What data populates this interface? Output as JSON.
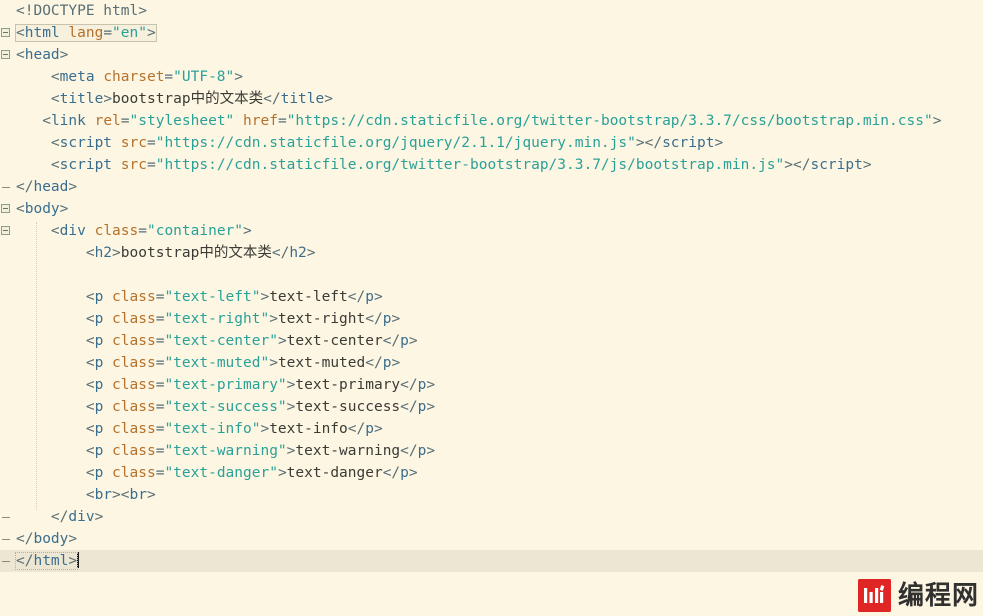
{
  "editor": {
    "theme_name": "solarized-light",
    "background_color": "#fdf6e3",
    "current_line_color": "#ede6d2",
    "colors": {
      "punctuation": "#586e75",
      "tag": "#3a6e8f",
      "attribute": "#b5712a",
      "string": "#2aa198",
      "text": "#3b3b36"
    },
    "language": "html",
    "lines": [
      {
        "n": 1,
        "fold": "",
        "indent": 0,
        "tokens": [
          {
            "t": "doctype",
            "v": "<!DOCTYPE html>"
          }
        ]
      },
      {
        "n": 2,
        "fold": "start",
        "indent": 0,
        "box": "match",
        "tokens": [
          {
            "t": "punc",
            "v": "<"
          },
          {
            "t": "tag",
            "v": "html"
          },
          {
            "t": "text",
            "v": " "
          },
          {
            "t": "attr",
            "v": "lang"
          },
          {
            "t": "punc",
            "v": "="
          },
          {
            "t": "str",
            "v": "\"en\""
          },
          {
            "t": "punc",
            "v": ">"
          }
        ]
      },
      {
        "n": 3,
        "fold": "start",
        "indent": 0,
        "tokens": [
          {
            "t": "punc",
            "v": "<"
          },
          {
            "t": "tag",
            "v": "head"
          },
          {
            "t": "punc",
            "v": ">"
          }
        ]
      },
      {
        "n": 4,
        "fold": "",
        "indent": 4,
        "tokens": [
          {
            "t": "punc",
            "v": "<"
          },
          {
            "t": "tag",
            "v": "meta"
          },
          {
            "t": "text",
            "v": " "
          },
          {
            "t": "attr",
            "v": "charset"
          },
          {
            "t": "punc",
            "v": "="
          },
          {
            "t": "str",
            "v": "\"UTF-8\""
          },
          {
            "t": "punc",
            "v": ">"
          }
        ]
      },
      {
        "n": 5,
        "fold": "",
        "indent": 4,
        "tokens": [
          {
            "t": "punc",
            "v": "<"
          },
          {
            "t": "tag",
            "v": "title"
          },
          {
            "t": "punc",
            "v": ">"
          },
          {
            "t": "text",
            "v": "bootstrap中的文本类"
          },
          {
            "t": "punc",
            "v": "</"
          },
          {
            "t": "tag",
            "v": "title"
          },
          {
            "t": "punc",
            "v": ">"
          }
        ]
      },
      {
        "n": 6,
        "fold": "",
        "indent": 3,
        "tokens": [
          {
            "t": "punc",
            "v": "<"
          },
          {
            "t": "tag",
            "v": "link"
          },
          {
            "t": "text",
            "v": " "
          },
          {
            "t": "attr",
            "v": "rel"
          },
          {
            "t": "punc",
            "v": "="
          },
          {
            "t": "str",
            "v": "\"stylesheet\""
          },
          {
            "t": "text",
            "v": " "
          },
          {
            "t": "attr",
            "v": "href"
          },
          {
            "t": "punc",
            "v": "="
          },
          {
            "t": "str",
            "v": "\"https://cdn.staticfile.org/twitter-bootstrap/3.3.7/css/bootstrap.min.css\""
          },
          {
            "t": "punc",
            "v": ">"
          }
        ]
      },
      {
        "n": 7,
        "fold": "",
        "indent": 4,
        "tokens": [
          {
            "t": "punc",
            "v": "<"
          },
          {
            "t": "tag",
            "v": "script"
          },
          {
            "t": "text",
            "v": " "
          },
          {
            "t": "attr",
            "v": "src"
          },
          {
            "t": "punc",
            "v": "="
          },
          {
            "t": "str",
            "v": "\"https://cdn.staticfile.org/jquery/2.1.1/jquery.min.js\""
          },
          {
            "t": "punc",
            "v": ">"
          },
          {
            "t": "punc",
            "v": "</"
          },
          {
            "t": "tag",
            "v": "script"
          },
          {
            "t": "punc",
            "v": ">"
          }
        ]
      },
      {
        "n": 8,
        "fold": "",
        "indent": 4,
        "tokens": [
          {
            "t": "punc",
            "v": "<"
          },
          {
            "t": "tag",
            "v": "script"
          },
          {
            "t": "text",
            "v": " "
          },
          {
            "t": "attr",
            "v": "src"
          },
          {
            "t": "punc",
            "v": "="
          },
          {
            "t": "str",
            "v": "\"https://cdn.staticfile.org/twitter-bootstrap/3.3.7/js/bootstrap.min.js\""
          },
          {
            "t": "punc",
            "v": ">"
          },
          {
            "t": "punc",
            "v": "</"
          },
          {
            "t": "tag",
            "v": "script"
          },
          {
            "t": "punc",
            "v": ">"
          }
        ]
      },
      {
        "n": 9,
        "fold": "end",
        "indent": 0,
        "tokens": [
          {
            "t": "punc",
            "v": "</"
          },
          {
            "t": "tag",
            "v": "head"
          },
          {
            "t": "punc",
            "v": ">"
          }
        ]
      },
      {
        "n": 10,
        "fold": "start",
        "indent": 0,
        "tokens": [
          {
            "t": "punc",
            "v": "<"
          },
          {
            "t": "tag",
            "v": "body"
          },
          {
            "t": "punc",
            "v": ">"
          }
        ]
      },
      {
        "n": 11,
        "fold": "start",
        "indent": 4,
        "tokens": [
          {
            "t": "punc",
            "v": "<"
          },
          {
            "t": "tag",
            "v": "div"
          },
          {
            "t": "text",
            "v": " "
          },
          {
            "t": "attr",
            "v": "class"
          },
          {
            "t": "punc",
            "v": "="
          },
          {
            "t": "str",
            "v": "\"container\""
          },
          {
            "t": "punc",
            "v": ">"
          }
        ]
      },
      {
        "n": 12,
        "fold": "",
        "indent": 8,
        "tokens": [
          {
            "t": "punc",
            "v": "<"
          },
          {
            "t": "tag",
            "v": "h2"
          },
          {
            "t": "punc",
            "v": ">"
          },
          {
            "t": "text",
            "v": "bootstrap中的文本类"
          },
          {
            "t": "punc",
            "v": "</"
          },
          {
            "t": "tag",
            "v": "h2"
          },
          {
            "t": "punc",
            "v": ">"
          }
        ]
      },
      {
        "n": 13,
        "fold": "",
        "indent": 0,
        "tokens": []
      },
      {
        "n": 14,
        "fold": "",
        "indent": 8,
        "tokens": [
          {
            "t": "punc",
            "v": "<"
          },
          {
            "t": "tag",
            "v": "p"
          },
          {
            "t": "text",
            "v": " "
          },
          {
            "t": "attr",
            "v": "class"
          },
          {
            "t": "punc",
            "v": "="
          },
          {
            "t": "str",
            "v": "\"text-left\""
          },
          {
            "t": "punc",
            "v": ">"
          },
          {
            "t": "text",
            "v": "text-left"
          },
          {
            "t": "punc",
            "v": "</"
          },
          {
            "t": "tag",
            "v": "p"
          },
          {
            "t": "punc",
            "v": ">"
          }
        ]
      },
      {
        "n": 15,
        "fold": "",
        "indent": 8,
        "tokens": [
          {
            "t": "punc",
            "v": "<"
          },
          {
            "t": "tag",
            "v": "p"
          },
          {
            "t": "text",
            "v": " "
          },
          {
            "t": "attr",
            "v": "class"
          },
          {
            "t": "punc",
            "v": "="
          },
          {
            "t": "str",
            "v": "\"text-right\""
          },
          {
            "t": "punc",
            "v": ">"
          },
          {
            "t": "text",
            "v": "text-right"
          },
          {
            "t": "punc",
            "v": "</"
          },
          {
            "t": "tag",
            "v": "p"
          },
          {
            "t": "punc",
            "v": ">"
          }
        ]
      },
      {
        "n": 16,
        "fold": "",
        "indent": 8,
        "tokens": [
          {
            "t": "punc",
            "v": "<"
          },
          {
            "t": "tag",
            "v": "p"
          },
          {
            "t": "text",
            "v": " "
          },
          {
            "t": "attr",
            "v": "class"
          },
          {
            "t": "punc",
            "v": "="
          },
          {
            "t": "str",
            "v": "\"text-center\""
          },
          {
            "t": "punc",
            "v": ">"
          },
          {
            "t": "text",
            "v": "text-center"
          },
          {
            "t": "punc",
            "v": "</"
          },
          {
            "t": "tag",
            "v": "p"
          },
          {
            "t": "punc",
            "v": ">"
          }
        ]
      },
      {
        "n": 17,
        "fold": "",
        "indent": 8,
        "tokens": [
          {
            "t": "punc",
            "v": "<"
          },
          {
            "t": "tag",
            "v": "p"
          },
          {
            "t": "text",
            "v": " "
          },
          {
            "t": "attr",
            "v": "class"
          },
          {
            "t": "punc",
            "v": "="
          },
          {
            "t": "str",
            "v": "\"text-muted\""
          },
          {
            "t": "punc",
            "v": ">"
          },
          {
            "t": "text",
            "v": "text-muted"
          },
          {
            "t": "punc",
            "v": "</"
          },
          {
            "t": "tag",
            "v": "p"
          },
          {
            "t": "punc",
            "v": ">"
          }
        ]
      },
      {
        "n": 18,
        "fold": "",
        "indent": 8,
        "tokens": [
          {
            "t": "punc",
            "v": "<"
          },
          {
            "t": "tag",
            "v": "p"
          },
          {
            "t": "text",
            "v": " "
          },
          {
            "t": "attr",
            "v": "class"
          },
          {
            "t": "punc",
            "v": "="
          },
          {
            "t": "str",
            "v": "\"text-primary\""
          },
          {
            "t": "punc",
            "v": ">"
          },
          {
            "t": "text",
            "v": "text-primary"
          },
          {
            "t": "punc",
            "v": "</"
          },
          {
            "t": "tag",
            "v": "p"
          },
          {
            "t": "punc",
            "v": ">"
          }
        ]
      },
      {
        "n": 19,
        "fold": "",
        "indent": 8,
        "tokens": [
          {
            "t": "punc",
            "v": "<"
          },
          {
            "t": "tag",
            "v": "p"
          },
          {
            "t": "text",
            "v": " "
          },
          {
            "t": "attr",
            "v": "class"
          },
          {
            "t": "punc",
            "v": "="
          },
          {
            "t": "str",
            "v": "\"text-success\""
          },
          {
            "t": "punc",
            "v": ">"
          },
          {
            "t": "text",
            "v": "text-success"
          },
          {
            "t": "punc",
            "v": "</"
          },
          {
            "t": "tag",
            "v": "p"
          },
          {
            "t": "punc",
            "v": ">"
          }
        ]
      },
      {
        "n": 20,
        "fold": "",
        "indent": 8,
        "tokens": [
          {
            "t": "punc",
            "v": "<"
          },
          {
            "t": "tag",
            "v": "p"
          },
          {
            "t": "text",
            "v": " "
          },
          {
            "t": "attr",
            "v": "class"
          },
          {
            "t": "punc",
            "v": "="
          },
          {
            "t": "str",
            "v": "\"text-info\""
          },
          {
            "t": "punc",
            "v": ">"
          },
          {
            "t": "text",
            "v": "text-info"
          },
          {
            "t": "punc",
            "v": "</"
          },
          {
            "t": "tag",
            "v": "p"
          },
          {
            "t": "punc",
            "v": ">"
          }
        ]
      },
      {
        "n": 21,
        "fold": "",
        "indent": 8,
        "tokens": [
          {
            "t": "punc",
            "v": "<"
          },
          {
            "t": "tag",
            "v": "p"
          },
          {
            "t": "text",
            "v": " "
          },
          {
            "t": "attr",
            "v": "class"
          },
          {
            "t": "punc",
            "v": "="
          },
          {
            "t": "str",
            "v": "\"text-warning\""
          },
          {
            "t": "punc",
            "v": ">"
          },
          {
            "t": "text",
            "v": "text-warning"
          },
          {
            "t": "punc",
            "v": "</"
          },
          {
            "t": "tag",
            "v": "p"
          },
          {
            "t": "punc",
            "v": ">"
          }
        ]
      },
      {
        "n": 22,
        "fold": "",
        "indent": 8,
        "tokens": [
          {
            "t": "punc",
            "v": "<"
          },
          {
            "t": "tag",
            "v": "p"
          },
          {
            "t": "text",
            "v": " "
          },
          {
            "t": "attr",
            "v": "class"
          },
          {
            "t": "punc",
            "v": "="
          },
          {
            "t": "str",
            "v": "\"text-danger\""
          },
          {
            "t": "punc",
            "v": ">"
          },
          {
            "t": "text",
            "v": "text-danger"
          },
          {
            "t": "punc",
            "v": "</"
          },
          {
            "t": "tag",
            "v": "p"
          },
          {
            "t": "punc",
            "v": ">"
          }
        ]
      },
      {
        "n": 23,
        "fold": "",
        "indent": 8,
        "tokens": [
          {
            "t": "punc",
            "v": "<"
          },
          {
            "t": "tag",
            "v": "br"
          },
          {
            "t": "punc",
            "v": ">"
          },
          {
            "t": "punc",
            "v": "<"
          },
          {
            "t": "tag",
            "v": "br"
          },
          {
            "t": "punc",
            "v": ">"
          }
        ]
      },
      {
        "n": 24,
        "fold": "end",
        "indent": 4,
        "tokens": [
          {
            "t": "punc",
            "v": "</"
          },
          {
            "t": "tag",
            "v": "div"
          },
          {
            "t": "punc",
            "v": ">"
          }
        ]
      },
      {
        "n": 25,
        "fold": "end",
        "indent": 0,
        "tokens": [
          {
            "t": "punc",
            "v": "</"
          },
          {
            "t": "tag",
            "v": "body"
          },
          {
            "t": "punc",
            "v": ">"
          }
        ]
      },
      {
        "n": 26,
        "fold": "end",
        "indent": 0,
        "current": true,
        "box": "match",
        "caret": true,
        "tokens": [
          {
            "t": "punc",
            "v": "</"
          },
          {
            "t": "tag",
            "v": "html"
          },
          {
            "t": "punc",
            "v": ">"
          }
        ]
      }
    ]
  },
  "watermark": {
    "label": "编程网",
    "logo_color": "#e01f1f",
    "logo_name": "biancheng-logo"
  }
}
